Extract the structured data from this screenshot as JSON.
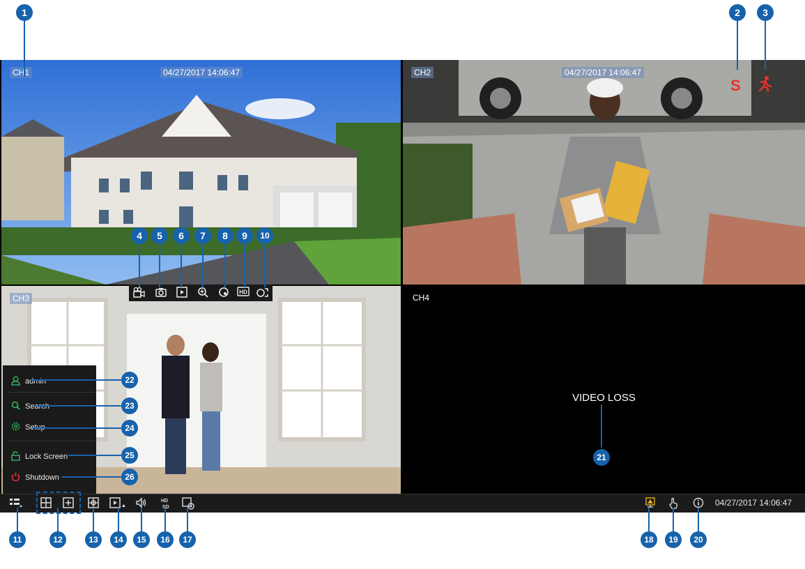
{
  "channels": [
    {
      "label": "CH1",
      "timestamp": "04/27/2017 14:06:47"
    },
    {
      "label": "CH2",
      "timestamp": "04/27/2017 14:06:47"
    },
    {
      "label": "CH3"
    },
    {
      "label": "CH4",
      "message": "VIDEO LOSS"
    }
  ],
  "status_icons": {
    "record_letter": "S"
  },
  "menu": {
    "items": [
      {
        "label": "admin",
        "icon": "user-icon"
      },
      {
        "label": "Search",
        "icon": "search-icon"
      },
      {
        "label": "Setup",
        "icon": "gear-icon"
      },
      {
        "label": "Lock Screen",
        "icon": "lock-icon"
      },
      {
        "label": "Shutdown",
        "icon": "power-icon"
      }
    ]
  },
  "taskbar": {
    "datetime": "04/27/2017 14:06:47"
  },
  "callouts": [
    "1",
    "2",
    "3",
    "4",
    "5",
    "6",
    "7",
    "8",
    "9",
    "10",
    "11",
    "12",
    "13",
    "14",
    "15",
    "16",
    "17",
    "18",
    "19",
    "20",
    "21",
    "22",
    "23",
    "24",
    "25",
    "26"
  ],
  "colors": {
    "callout": "#1662ab",
    "accent_green": "#30b060",
    "alert_red": "#e8322a"
  }
}
